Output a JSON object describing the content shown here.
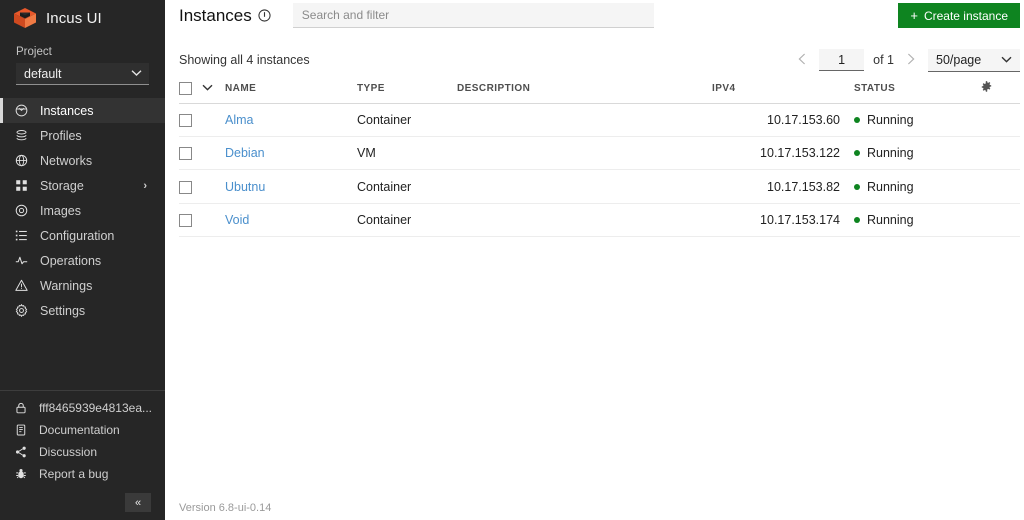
{
  "sidebar": {
    "brand": "Incus UI",
    "brand_logo_icon": "incus-cube-logo",
    "project": {
      "label": "Project",
      "value": "default",
      "chevron_icon": "chevron-down-icon"
    },
    "nav_items": [
      {
        "label": "Instances",
        "icon": "instances-icon",
        "active": true,
        "expandable": false
      },
      {
        "label": "Profiles",
        "icon": "profiles-icon",
        "active": false,
        "expandable": false
      },
      {
        "label": "Networks",
        "icon": "networks-icon",
        "active": false,
        "expandable": false
      },
      {
        "label": "Storage",
        "icon": "storage-icon",
        "active": false,
        "expandable": true
      },
      {
        "label": "Images",
        "icon": "images-icon",
        "active": false,
        "expandable": false
      },
      {
        "label": "Configuration",
        "icon": "configuration-icon",
        "active": false,
        "expandable": false
      },
      {
        "label": "Operations",
        "icon": "operations-icon",
        "active": false,
        "expandable": false
      },
      {
        "label": "Warnings",
        "icon": "warnings-icon",
        "active": false,
        "expandable": false
      },
      {
        "label": "Settings",
        "icon": "settings-icon",
        "active": false,
        "expandable": false
      }
    ],
    "bottom_items": [
      {
        "label": "fff8465939e4813ea...",
        "icon": "lock-icon"
      },
      {
        "label": "Documentation",
        "icon": "book-icon"
      },
      {
        "label": "Discussion",
        "icon": "share-icon"
      },
      {
        "label": "Report a bug",
        "icon": "bug-icon"
      }
    ],
    "collapse_button": {
      "label": "«",
      "icon": "double-chevron-left-icon"
    }
  },
  "header": {
    "title": "Instances",
    "title_info_icon": "info-circle-icon",
    "search": {
      "placeholder": "Search and filter",
      "value": ""
    },
    "create_button": {
      "label": "Create instance",
      "icon": "plus-icon",
      "color": "#0e8420"
    }
  },
  "toolbar": {
    "showing_text": "Showing all 4 instances",
    "pagination": {
      "prev_icon": "chevron-left-icon",
      "next_icon": "chevron-right-icon",
      "current_page": "1",
      "of_label": "of 1",
      "page_size": "50/page",
      "page_size_chevron_icon": "chevron-down-icon"
    }
  },
  "table": {
    "select_all_chevron_icon": "chevron-down-icon",
    "settings_icon": "gear-icon",
    "columns": [
      "NAME",
      "TYPE",
      "DESCRIPTION",
      "IPV4",
      "STATUS"
    ],
    "rows": [
      {
        "name": "Alma",
        "type": "Container",
        "description": "",
        "ipv4": "10.17.153.60",
        "status": "Running",
        "status_color": "#0e8420"
      },
      {
        "name": "Debian",
        "type": "VM",
        "description": "",
        "ipv4": "10.17.153.122",
        "status": "Running",
        "status_color": "#0e8420"
      },
      {
        "name": "Ubutnu",
        "type": "Container",
        "description": "",
        "ipv4": "10.17.153.82",
        "status": "Running",
        "status_color": "#0e8420"
      },
      {
        "name": "Void",
        "type": "Container",
        "description": "",
        "ipv4": "10.17.153.174",
        "status": "Running",
        "status_color": "#0e8420"
      }
    ]
  },
  "footer": {
    "version": "Version 6.8-ui-0.14"
  }
}
